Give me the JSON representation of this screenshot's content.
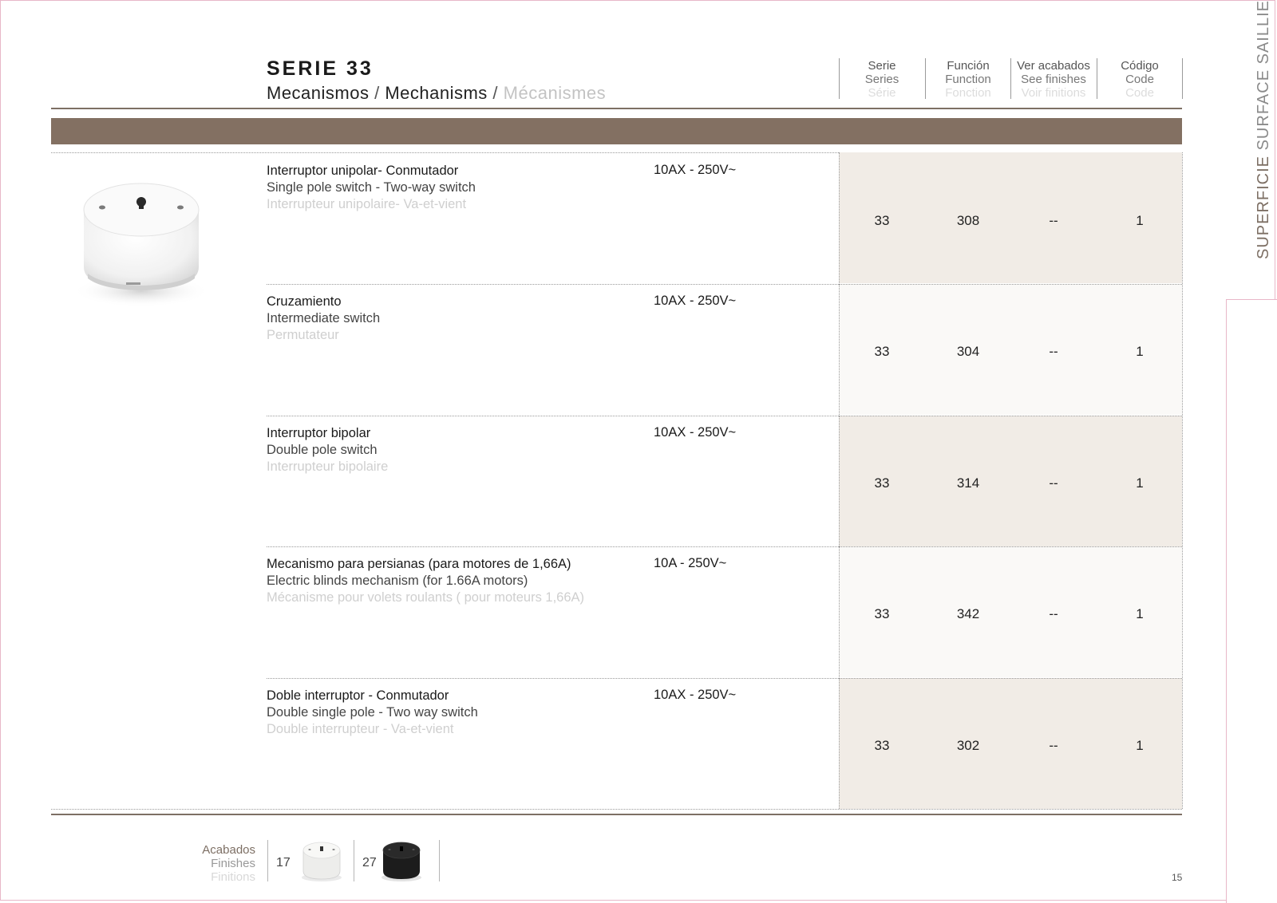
{
  "header": {
    "title": "SERIE 33",
    "subtitle_es": "Mecanismos",
    "subtitle_sep": " / ",
    "subtitle_en": "Mechanisms",
    "subtitle_fr": "Mécanismes"
  },
  "side_label": {
    "strong": "SUPERFICIE",
    "light": "SURFACE SAILLIE"
  },
  "columns": [
    {
      "es": "Serie",
      "en": "Series",
      "fr": "Série"
    },
    {
      "es": "Función",
      "en": "Function",
      "fr": "Fonction"
    },
    {
      "es": "Ver acabados",
      "en": "See finishes",
      "fr": "Voir finitions"
    },
    {
      "es": "Código",
      "en": "Code",
      "fr": "Code"
    }
  ],
  "rows": [
    {
      "es": "Interruptor unipolar- Conmutador",
      "en": "Single pole switch - Two-way switch",
      "fr": "Interrupteur unipolaire- Va-et-vient",
      "spec": "10AX - 250V~",
      "serie": "33",
      "funcion": "308",
      "acabados": "--",
      "codigo": "1"
    },
    {
      "es": "Cruzamiento",
      "en": "Intermediate switch",
      "fr": "Permutateur",
      "spec": "10AX - 250V~",
      "serie": "33",
      "funcion": "304",
      "acabados": "--",
      "codigo": "1"
    },
    {
      "es": "Interruptor bipolar",
      "en": "Double pole switch",
      "fr": "Interrupteur bipolaire",
      "spec": "10AX - 250V~",
      "serie": "33",
      "funcion": "314",
      "acabados": "--",
      "codigo": "1"
    },
    {
      "es": "Mecanismo para persianas (para motores de 1,66A)",
      "en": "Electric blinds mechanism (for 1.66A motors)",
      "fr": "Mécanisme pour volets roulants ( pour moteurs 1,66A)",
      "spec": "10A - 250V~",
      "serie": "33",
      "funcion": "342",
      "acabados": "--",
      "codigo": "1"
    },
    {
      "es": "Doble interruptor - Conmutador",
      "en": "Double single pole - Two way switch",
      "fr": "Double interrupteur - Va-et-vient",
      "spec": "10AX - 250V~",
      "serie": "33",
      "funcion": "302",
      "acabados": "--",
      "codigo": "1"
    }
  ],
  "finishes": {
    "label_es": "Acabados",
    "label_en": "Finishes",
    "label_fr": "Finitions",
    "items": [
      {
        "code": "17",
        "color": "#f2f2f0"
      },
      {
        "code": "27",
        "color": "#1c1c1c"
      }
    ]
  },
  "page_number": "15"
}
